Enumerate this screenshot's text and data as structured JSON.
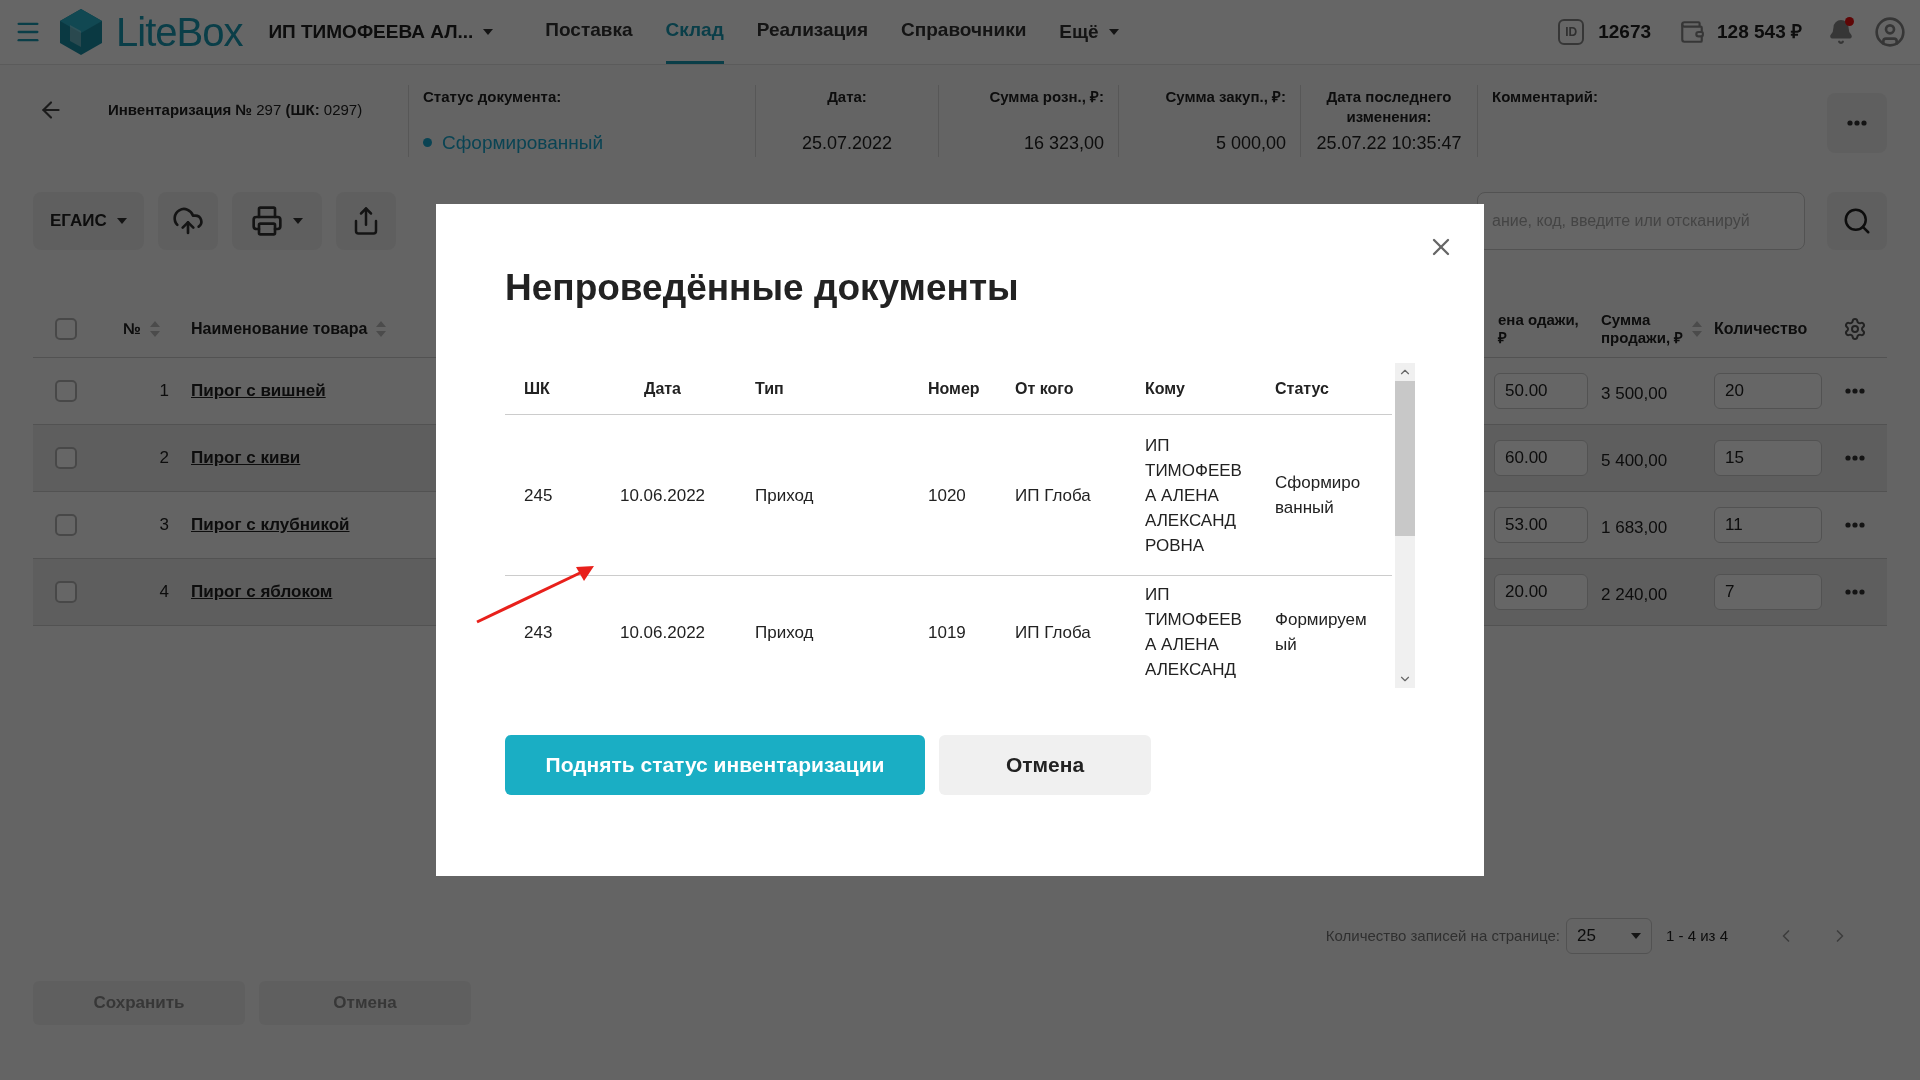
{
  "top_bar": {
    "logo": "LiteBox",
    "org": "ИП ТИМОФЕЕВА АЛ...",
    "nav": [
      {
        "label": "Поставка",
        "selected": false
      },
      {
        "label": "Склад",
        "selected": true
      },
      {
        "label": "Реализация",
        "selected": false
      },
      {
        "label": "Справочники",
        "selected": false
      }
    ],
    "more": "Ещё",
    "id_badge": "ID",
    "id_value": "12673",
    "balance": "128 543 ₽",
    "has_notifications": true
  },
  "document": {
    "title": "**Инвентаризация №** 297 **(ШК:** 0297)",
    "fields": [
      {
        "kind": "status",
        "label": "Статус документа:",
        "value": "Сформированный"
      },
      {
        "kind": "center",
        "label": "Дата:",
        "value": "25.07.2022"
      },
      {
        "kind": "right",
        "label": "Сумма розн., ₽:",
        "value": "16 323,00"
      },
      {
        "kind": "right",
        "label": "Сумма закуп., ₽:",
        "value": "5 000,00"
      },
      {
        "kind": "center",
        "label": "Дата последнего изменения:",
        "value": "25.07.22 10:35:47"
      },
      {
        "kind": "left",
        "label": "Комментарий:"
      }
    ]
  },
  "toolbar": {
    "egais": "ЕГАИС",
    "search_placeholder": "ание, код, введите или отсканируй"
  },
  "table": {
    "select_all": {
      "checked": false
    },
    "columns": [
      "№",
      "Наименование товара",
      "ена одажи, ₽",
      "Сумма продажи, ₽",
      "Количество"
    ],
    "rows": [
      {
        "checked": false,
        "num": "1",
        "name": "Пирог с вишней",
        "price": "50.00",
        "sum": "3 500,00",
        "qty": "20"
      },
      {
        "checked": false,
        "num": "2",
        "name": "Пирог с киви",
        "price": "60.00",
        "sum": "5 400,00",
        "qty": "15"
      },
      {
        "checked": false,
        "num": "3",
        "name": "Пирог с клубникой",
        "price": "53.00",
        "sum": "1 683,00",
        "qty": "11"
      },
      {
        "checked": false,
        "num": "4",
        "name": "Пирог с яблоком",
        "price": "20.00",
        "sum": "2 240,00",
        "qty": "7"
      }
    ]
  },
  "pagination": {
    "label": "Количество записей на странице:",
    "page_size": "25",
    "range": "1 - 4 из 4"
  },
  "footer_buttons": [
    {
      "label": "Сохранить",
      "disabled": true
    },
    {
      "label": "Отмена",
      "disabled": true
    }
  ],
  "modal": {
    "title": "Непроведённые документы",
    "columns": [
      "ШК",
      "Дата",
      "Тип",
      "Номер",
      "От кого",
      "Кому",
      "Статус"
    ],
    "rows": [
      [
        "245",
        "10.06.2022",
        "Приход",
        "1020",
        "ИП Глоба",
        "ИП ТИМОФЕЕВА АЛЕНА АЛЕКСАНДРОВНА",
        "Сформированный"
      ],
      [
        "243",
        "10.06.2022",
        "Приход",
        "1019",
        "ИП Глоба",
        "ИП ТИМОФЕЕВА АЛЕНА АЛЕКСАНД",
        "Формируемый"
      ]
    ],
    "primary_button": "Поднять статус инвентаризации",
    "cancel_button": "Отмена"
  }
}
